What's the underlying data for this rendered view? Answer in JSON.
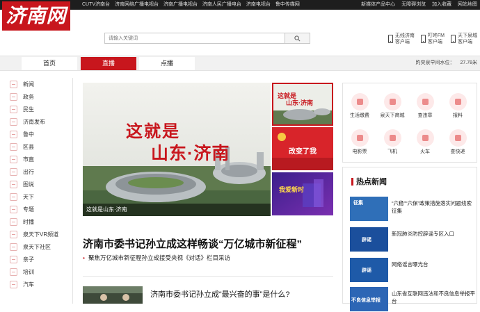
{
  "topbar": {
    "station": "CUTV济南台",
    "links": [
      "济南网络广播电视台",
      "济南广播电视台",
      "济南人民广播电台",
      "济南电视台",
      "鲁中传媒网"
    ],
    "right_links": [
      "新媒体产品中心",
      "无障碍浏览",
      "加入收藏",
      "网站地图"
    ]
  },
  "logo": {
    "text": "济南网"
  },
  "search": {
    "placeholder": "请输入关键词"
  },
  "apps": [
    {
      "line1": "无线济南",
      "line2": "客户端"
    },
    {
      "line1": "叮咚FM",
      "line2": "客户端"
    },
    {
      "line1": "天下泉城",
      "line2": "客户端"
    }
  ],
  "nav": {
    "tabs": [
      {
        "label": "首页"
      },
      {
        "label": "直播"
      },
      {
        "label": "点播"
      }
    ],
    "water_label": "趵突泉早间水位：",
    "water_value": "27.78米"
  },
  "sidebar": {
    "items": [
      "新闻",
      "政务",
      "民生",
      "济南发布",
      "鲁中",
      "区县",
      "市直",
      "出行",
      "图说",
      "天下",
      "专题",
      "时播",
      "泉天下VR频道",
      "泉天下社区",
      "亲子",
      "培训",
      "汽车"
    ]
  },
  "hero": {
    "poster_line1": "这就是",
    "poster_line2": "山东·济南",
    "caption": "这就是山东·济南"
  },
  "thumbs": {
    "t1_line1": "这就是",
    "t1_line2": "山东·济南",
    "t2_text": "改变了我",
    "t3_text": "我爱新时"
  },
  "main": {
    "headline": "济南市委书记孙立成这样畅谈“万亿城市新征程”",
    "subline": "聚焦万亿城市新征程孙立成接受央视《对话》栏目采访",
    "news2_title": "济南市委书记孙立成“最兴奋的事”是什么?"
  },
  "services": [
    {
      "label": "生活缴费"
    },
    {
      "label": "泉天下商城"
    },
    {
      "label": "查违章"
    },
    {
      "label": "报料"
    },
    {
      "label": "电影票"
    },
    {
      "label": "飞机"
    },
    {
      "label": "火车"
    },
    {
      "label": "查快递"
    }
  ],
  "hot_news": {
    "title": "热点新闻",
    "items": [
      {
        "img_text": "征集",
        "text": "“六稳”“六保”政策措施落实问题线索征集"
      },
      {
        "img_text": "辟谣",
        "text": "新冠肺炎防控辟谣专区入口"
      },
      {
        "img_text": "辟谣",
        "text": "网络谣言曝光台"
      },
      {
        "img_text": "不良信息举报",
        "text": "山东省互联网违法和不良信息举报平台"
      }
    ]
  },
  "colors": {
    "brand_red": "#c8161d",
    "topbar": "#1e1e1e",
    "nav_bg": "#f1f1f1"
  }
}
